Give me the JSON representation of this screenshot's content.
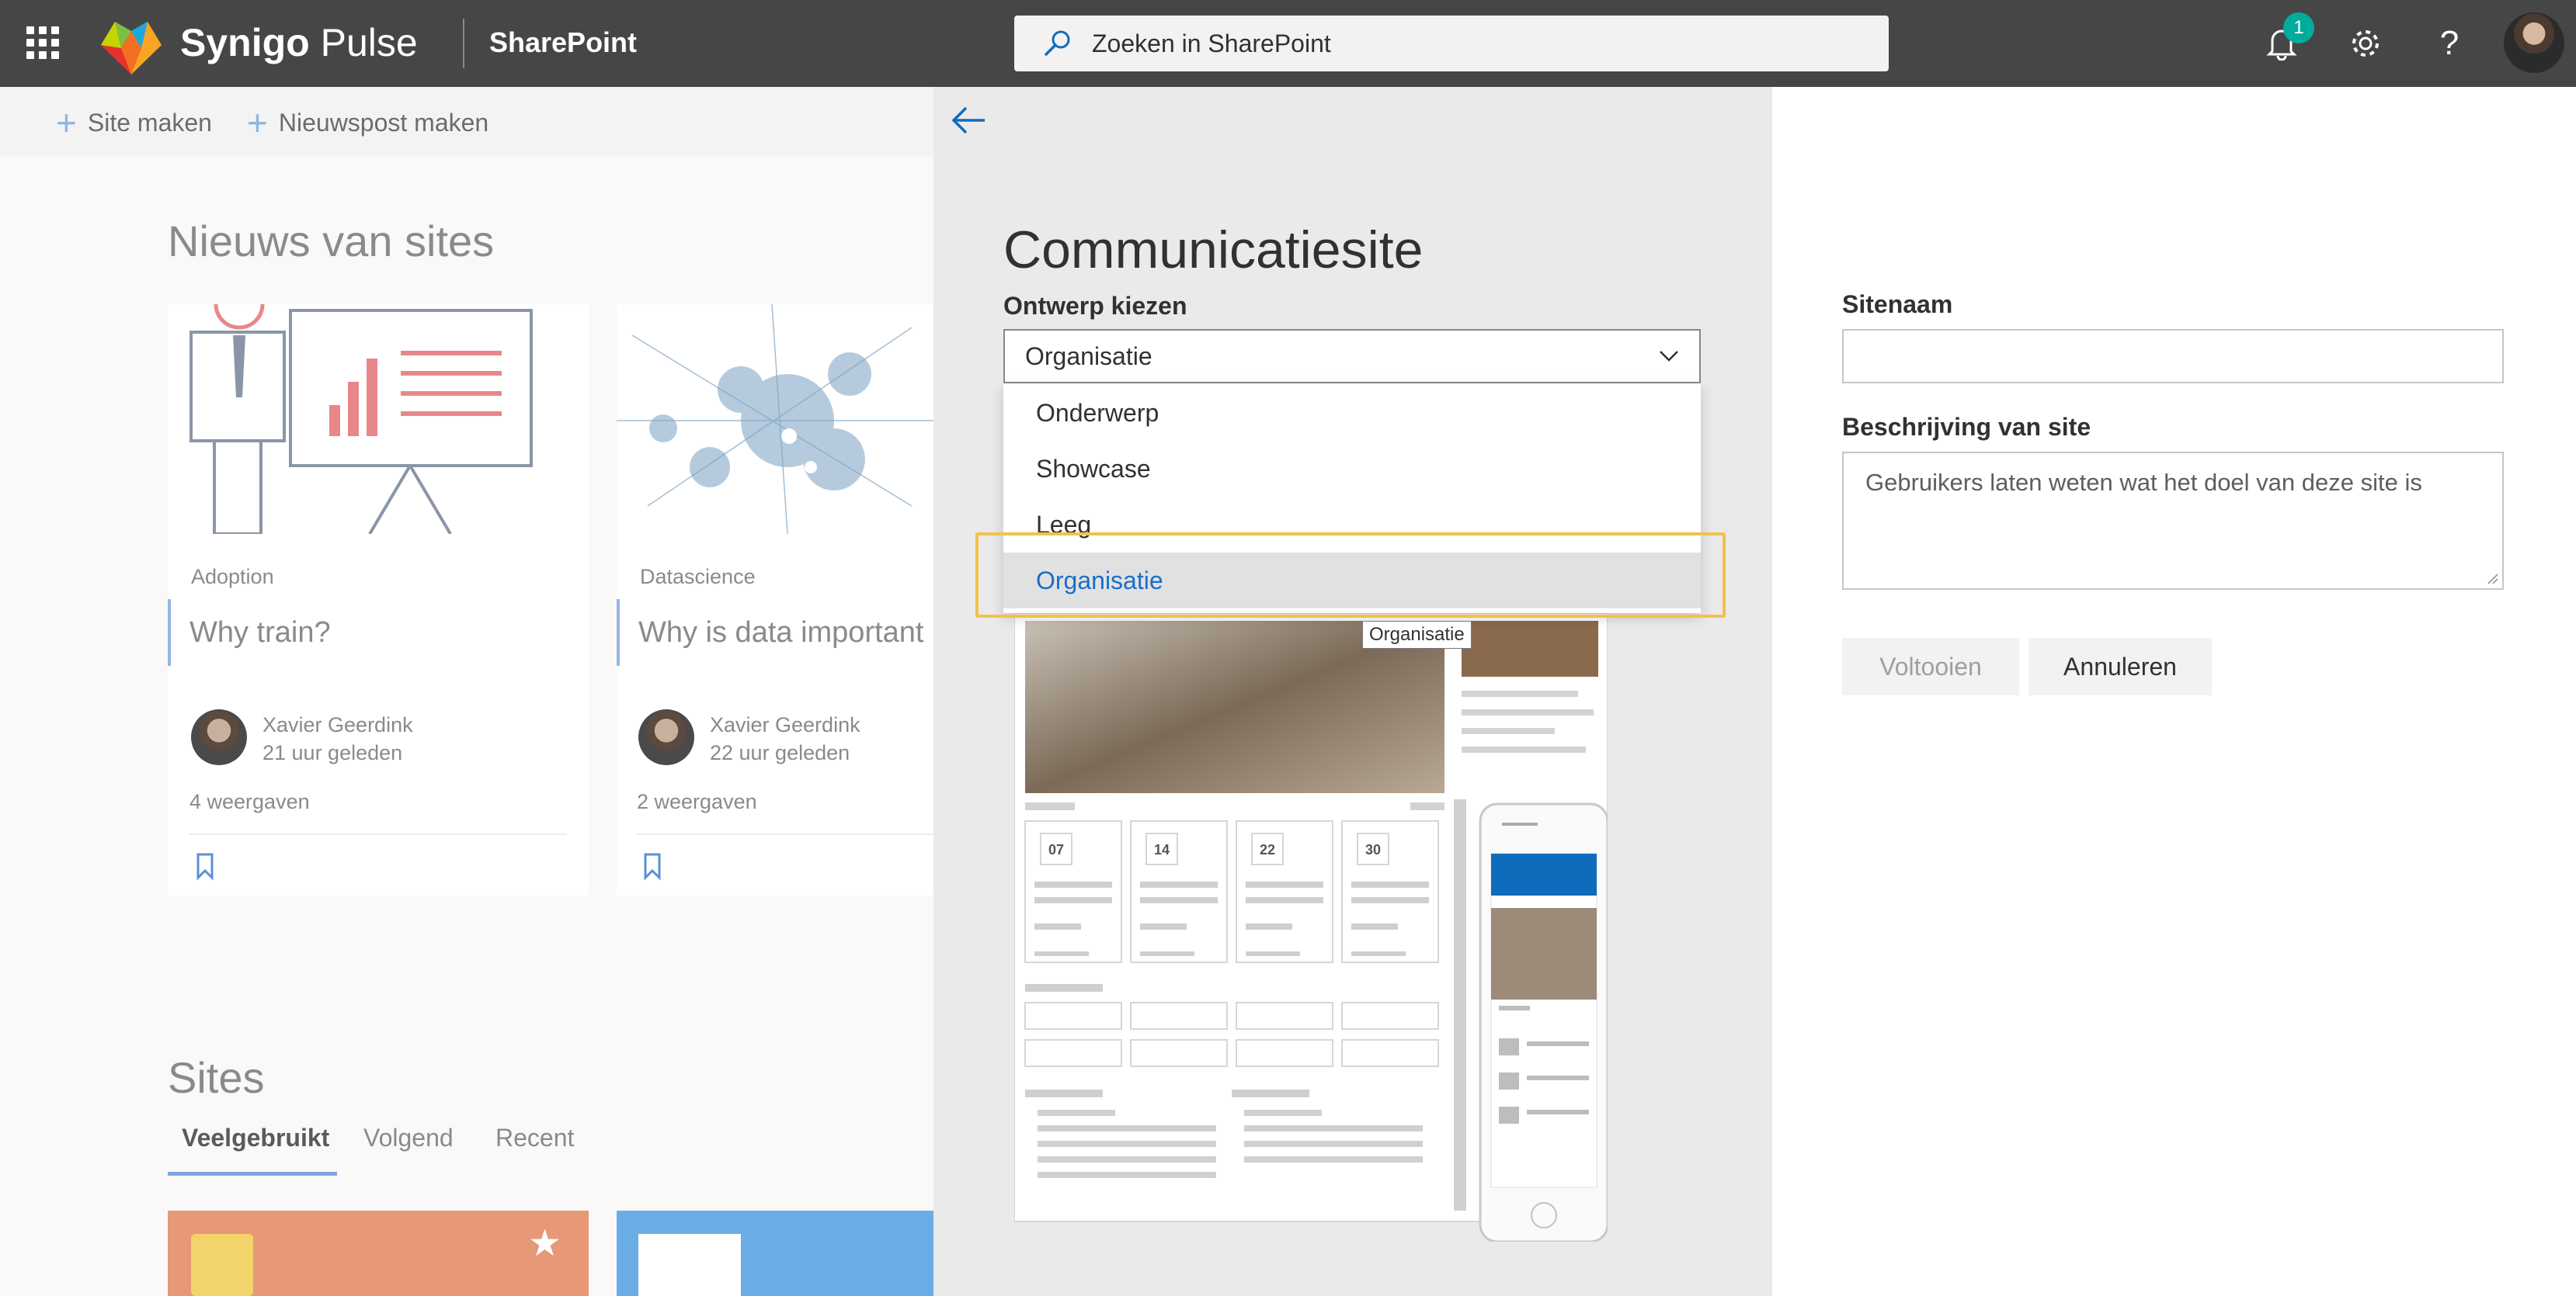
{
  "topbar": {
    "brand_name": "Synigo",
    "brand_suffix": "Pulse",
    "product": "SharePoint",
    "search_placeholder": "Zoeken in SharePoint",
    "notification_count": "1",
    "help_label": "?"
  },
  "commands": {
    "create_site": "Site maken",
    "create_news": "Nieuwspost maken"
  },
  "news": {
    "heading": "Nieuws van sites",
    "cards": [
      {
        "category": "Adoption",
        "title": "Why train?",
        "author": "Xavier Geerdink",
        "time": "21 uur geleden",
        "views": "4 weergaven"
      },
      {
        "category": "Datascience",
        "title": "Why is data important",
        "author": "Xavier Geerdink",
        "time": "22 uur geleden",
        "views": "2 weergaven"
      }
    ]
  },
  "sites": {
    "heading": "Sites",
    "tabs": [
      "Veelgebruikt",
      "Volgend",
      "Recent"
    ]
  },
  "panel": {
    "title": "Communicatiesite",
    "design_label": "Ontwerp kiezen",
    "selected_design": "Organisatie",
    "options": [
      "Onderwerp",
      "Showcase",
      "Leeg",
      "Organisatie"
    ],
    "tooltip": "Organisatie",
    "site_name_label": "Sitenaam",
    "site_name_value": "",
    "description_label": "Beschrijving van site",
    "description_placeholder": "Gebruikers laten weten wat het doel van deze site is",
    "finish_button": "Voltooien",
    "cancel_button": "Annuleren",
    "preview_dates": [
      "07",
      "14",
      "22",
      "30"
    ]
  }
}
